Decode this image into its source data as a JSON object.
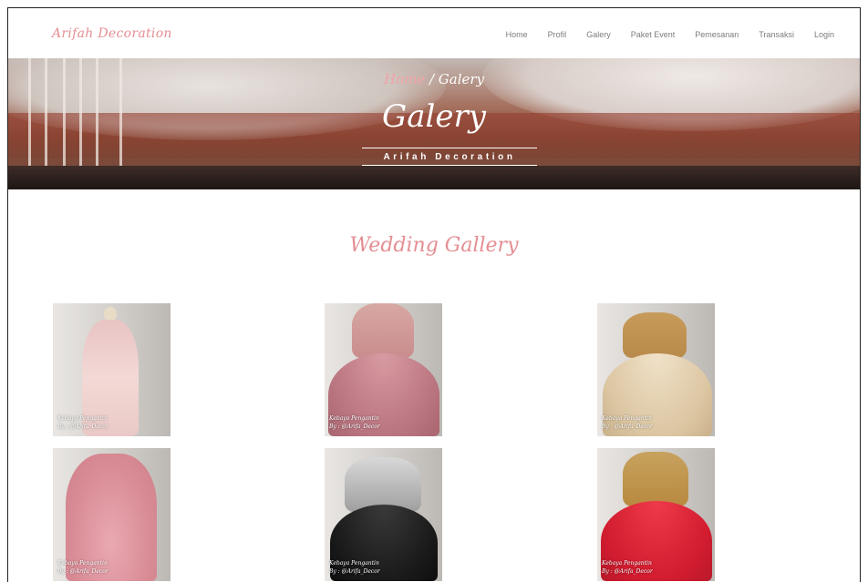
{
  "nav": {
    "brand": "Arifah Decoration",
    "items": [
      "Home",
      "Profil",
      "Galery",
      "Paket Event",
      "Pemesanan",
      "Transaksi",
      "Login"
    ]
  },
  "hero": {
    "breadcrumb_home": "Home",
    "breadcrumb_sep": " / ",
    "breadcrumb_current": "Galery",
    "title": "Galery",
    "subtitle": "Arifah Decoration"
  },
  "gallery": {
    "title": "Wedding Gallery",
    "items": [
      {
        "caption_line1": "Kebaya Pengantin",
        "caption_line2": "By : @Arifa_Decor"
      },
      {
        "caption_line1": "Kebaya Pengantin",
        "caption_line2": "By : @Arifa_Decor"
      },
      {
        "caption_line1": "Kebaya Pengantin",
        "caption_line2": "By : @Arifa_Decor"
      },
      {
        "caption_line1": "Kebaya Pengantin",
        "caption_line2": "By : @Arifa_Decor"
      },
      {
        "caption_line1": "Kebaya Pengantin",
        "caption_line2": "By : @Arifa_Decor"
      },
      {
        "caption_line1": "Kebaya Pengantin",
        "caption_line2": "By : @Arifa_Decor"
      }
    ]
  },
  "colors": {
    "accent": "#e58e93",
    "nav_text": "#7d7d7d"
  }
}
